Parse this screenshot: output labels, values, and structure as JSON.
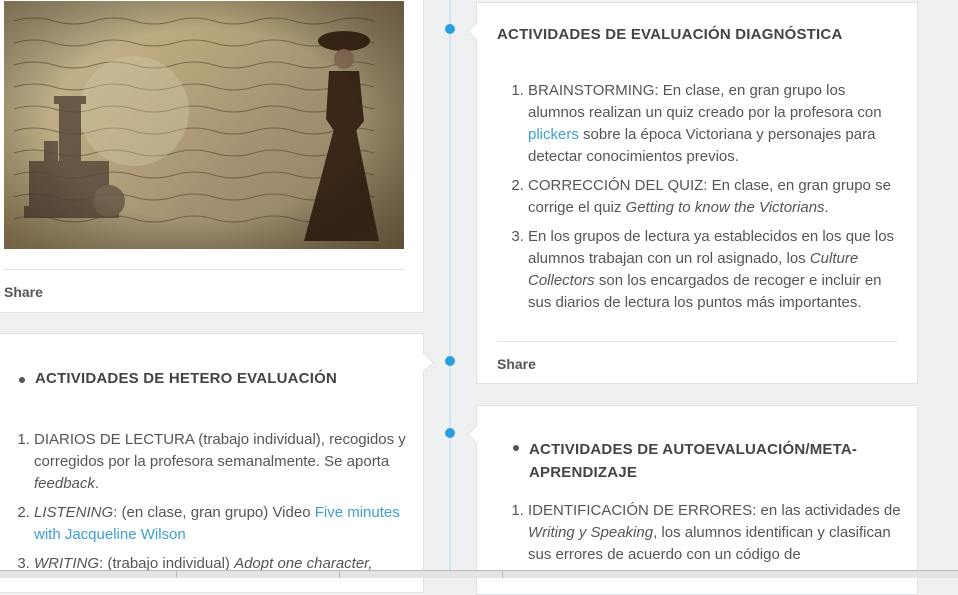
{
  "image_card": {
    "image_alt": "Victorian lady collage with handwritten letter background",
    "share_label": "Share"
  },
  "diagnostic": {
    "title": "ACTIVIDADES DE EVALUACIÓN DIAGNÓSTICA",
    "items": [
      {
        "pre": " BRAINSTORMING: En clase, en gran grupo los alumnos realizan un quiz creado por la profesora con ",
        "link": "plickers",
        "post": " sobre la época Victoriana y personajes para detectar conocimientos previos."
      },
      {
        "pre": "CORRECCIÓN DEL QUIZ: En clase, en gran grupo se corrige el quiz ",
        "em": "Getting to know the Victorians",
        "post": "."
      },
      {
        "pre": "En los grupos de lectura ya establecidos en los que los alumnos trabajan con un rol asignado, los ",
        "em": "Culture Collectors",
        "post": " son los encargados de recoger e incluir en sus diarios de lectura los puntos más importantes."
      }
    ],
    "share_label": "Share"
  },
  "hetero": {
    "title": "ACTIVIDADES DE HETERO EVALUACIÓN",
    "items": [
      {
        "pre": "DIARIOS DE LECTURA (trabajo individual), recogidos y corregidos por la profesora semanalmente. Se aporta ",
        "em": "feedback",
        "post": "."
      },
      {
        "em": "LISTENING",
        "pre": ": (en clase, gran grupo) Video ",
        "link": "Five minutes with Jacqueline Wilson"
      },
      {
        "em": "WRITING",
        "pre": ": (trabajo individual) ",
        "em2": "Adopt one character,"
      }
    ]
  },
  "auto": {
    "title": "ACTIVIDADES DE AUTOEVALUACIÓN/META-APRENDIZAJE",
    "items": [
      {
        "pre": "IDENTIFICACIÓN DE ERRORES: en las actividades de ",
        "em": "Writing y Speaking",
        "post": ", los alumnos identifican y clasifican sus errores de acuerdo con un código de"
      }
    ]
  }
}
